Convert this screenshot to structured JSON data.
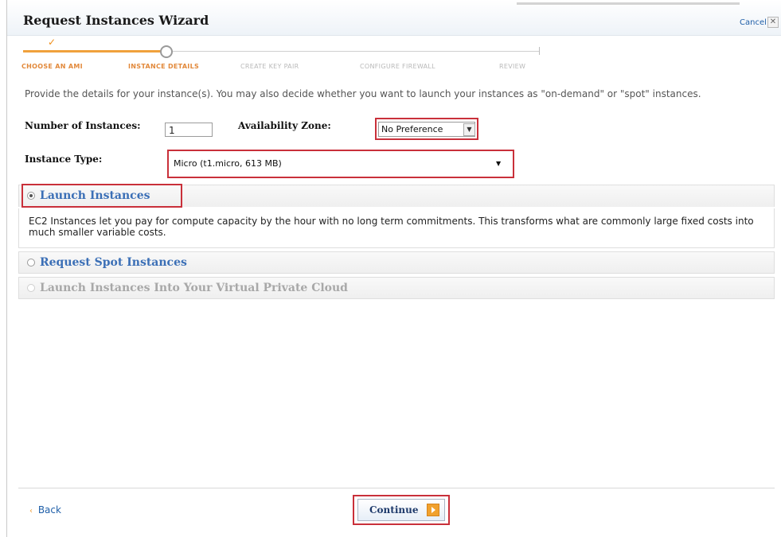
{
  "wizard": {
    "title": "Request Instances Wizard",
    "cancel_label": "Cancel",
    "cancel_x": "✕"
  },
  "steps": [
    {
      "label": "CHOOSE AN AMI",
      "state": "done"
    },
    {
      "label": "INSTANCE DETAILS",
      "state": "current"
    },
    {
      "label": "CREATE KEY PAIR",
      "state": "future"
    },
    {
      "label": "CONFIGURE FIREWALL",
      "state": "future"
    },
    {
      "label": "REVIEW",
      "state": "future"
    }
  ],
  "intro": "Provide the details for your instance(s). You may also decide whether you want to launch your instances as \"on-demand\" or \"spot\" instances.",
  "form": {
    "num_instances_label": "Number of Instances:",
    "num_instances_value": "1",
    "availability_zone_label": "Availability Zone:",
    "availability_zone_value": "No Preference",
    "instance_type_label": "Instance Type:",
    "instance_type_value": "Micro (t1.micro, 613 MB)"
  },
  "options": {
    "launch": {
      "label": "Launch Instances",
      "description": "EC2 Instances let you pay for compute capacity by the hour with no long term commitments. This transforms what are commonly large fixed costs into much smaller variable costs.",
      "selected": true
    },
    "spot": {
      "label": "Request Spot Instances",
      "selected": false
    },
    "vpc": {
      "label": "Launch Instances Into Your Virtual Private Cloud",
      "disabled": true
    }
  },
  "footer": {
    "back_label": "Back",
    "back_arrow": "‹",
    "continue_label": "Continue"
  },
  "colors": {
    "accent_orange": "#f0a13c",
    "link_blue": "#1f5fa8",
    "highlight_red": "#c9303a"
  }
}
